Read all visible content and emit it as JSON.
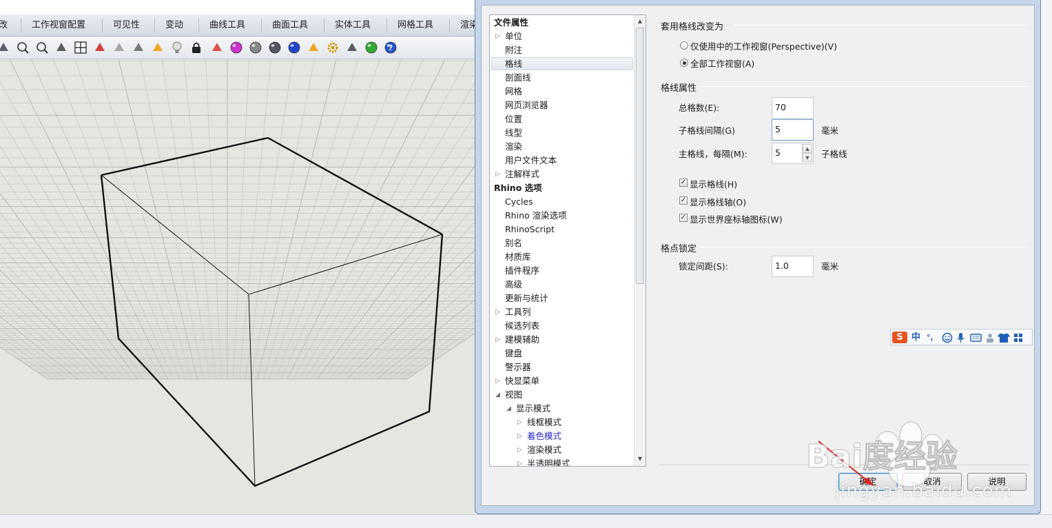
{
  "app": {
    "tabs": [
      "改",
      "工作视窗配置",
      "可见性",
      "变动",
      "曲线工具",
      "曲面工具",
      "实体工具",
      "网格工具",
      "渲染"
    ],
    "toolbar_icons": [
      "rotate-view-icon",
      "zoom-extents-icon",
      "zoom-window-icon",
      "undo-view-icon",
      "viewport-layout-icon",
      "car-render-icon",
      "eraser-icon",
      "circle-tool-icon",
      "sparkle-icon",
      "lightbulb-icon",
      "lock-icon",
      "material-icon",
      "color-wheel-icon",
      "sphere-wire-icon",
      "sphere-shaded-icon",
      "sphere-render-icon",
      "arrow-flag-icon",
      "gear-icon",
      "dimension-icon",
      "grasshopper-icon",
      "help-icon"
    ]
  },
  "dialog": {
    "tree": {
      "items": [
        {
          "label": "文件属性",
          "level": 0,
          "root": true
        },
        {
          "label": "单位",
          "level": 1,
          "arrow": "collapsed"
        },
        {
          "label": "附注",
          "level": 1
        },
        {
          "label": "格线",
          "level": 1
        },
        {
          "label": "剖面线",
          "level": 1
        },
        {
          "label": "网格",
          "level": 1
        },
        {
          "label": "网页浏览器",
          "level": 1
        },
        {
          "label": "位置",
          "level": 1
        },
        {
          "label": "线型",
          "level": 1
        },
        {
          "label": "渲染",
          "level": 1
        },
        {
          "label": "用户文件文本",
          "level": 1
        },
        {
          "label": "注解样式",
          "level": 1,
          "arrow": "collapsed"
        },
        {
          "label": "Rhino 选项",
          "level": 0,
          "root": true
        },
        {
          "label": "Cycles",
          "level": 1
        },
        {
          "label": "Rhino 渲染选项",
          "level": 1
        },
        {
          "label": "RhinoScript",
          "level": 1
        },
        {
          "label": "别名",
          "level": 1
        },
        {
          "label": "材质库",
          "level": 1
        },
        {
          "label": "插件程序",
          "level": 1
        },
        {
          "label": "高级",
          "level": 1
        },
        {
          "label": "更新与统计",
          "level": 1
        },
        {
          "label": "工具列",
          "level": 1,
          "arrow": "collapsed"
        },
        {
          "label": "候选列表",
          "level": 1
        },
        {
          "label": "建模辅助",
          "level": 1,
          "arrow": "collapsed"
        },
        {
          "label": "键盘",
          "level": 1
        },
        {
          "label": "警示器",
          "level": 1
        },
        {
          "label": "快显菜单",
          "level": 1,
          "arrow": "collapsed"
        },
        {
          "label": "视图",
          "level": 1,
          "arrow": "expanded"
        },
        {
          "label": "显示模式",
          "level": 2,
          "arrow": "expanded"
        },
        {
          "label": "线框模式",
          "level": 3,
          "arrow": "collapsed"
        },
        {
          "label": "着色模式",
          "level": 3,
          "arrow": "collapsed",
          "blue": true
        },
        {
          "label": "渲染模式",
          "level": 3,
          "arrow": "collapsed"
        },
        {
          "label": "半透明模式",
          "level": 3,
          "arrow": "collapsed"
        }
      ]
    },
    "apply": {
      "title": "套用格线改变为",
      "option_active": "仅使用中的工作视窗(Perspective)(V)",
      "option_all": "全部工作视窗(A)"
    },
    "grid": {
      "title": "格线属性",
      "total_label": "总格数(E):",
      "total_value": "70",
      "spacing_label": "子格线间隔(G)",
      "spacing_value": "5",
      "spacing_unit": "毫米",
      "major_label": "主格线，每隔(M):",
      "major_value": "5",
      "major_unit": "子格线",
      "show_grid": "显示格线(H)",
      "show_axes": "显示格线轴(O)",
      "show_world": "显示世界座标轴图标(W)"
    },
    "snap": {
      "title": "格点锁定",
      "label": "锁定间距(S):",
      "value": "1.0",
      "unit": "毫米"
    },
    "buttons": {
      "ok": "确定",
      "cancel": "取消",
      "help": "说明"
    },
    "ime": {
      "logo": "S",
      "mode": "中",
      "punct": "°,"
    }
  },
  "watermark": {
    "brand": "Bai度经验",
    "url": "jingyan.baidu.com"
  }
}
